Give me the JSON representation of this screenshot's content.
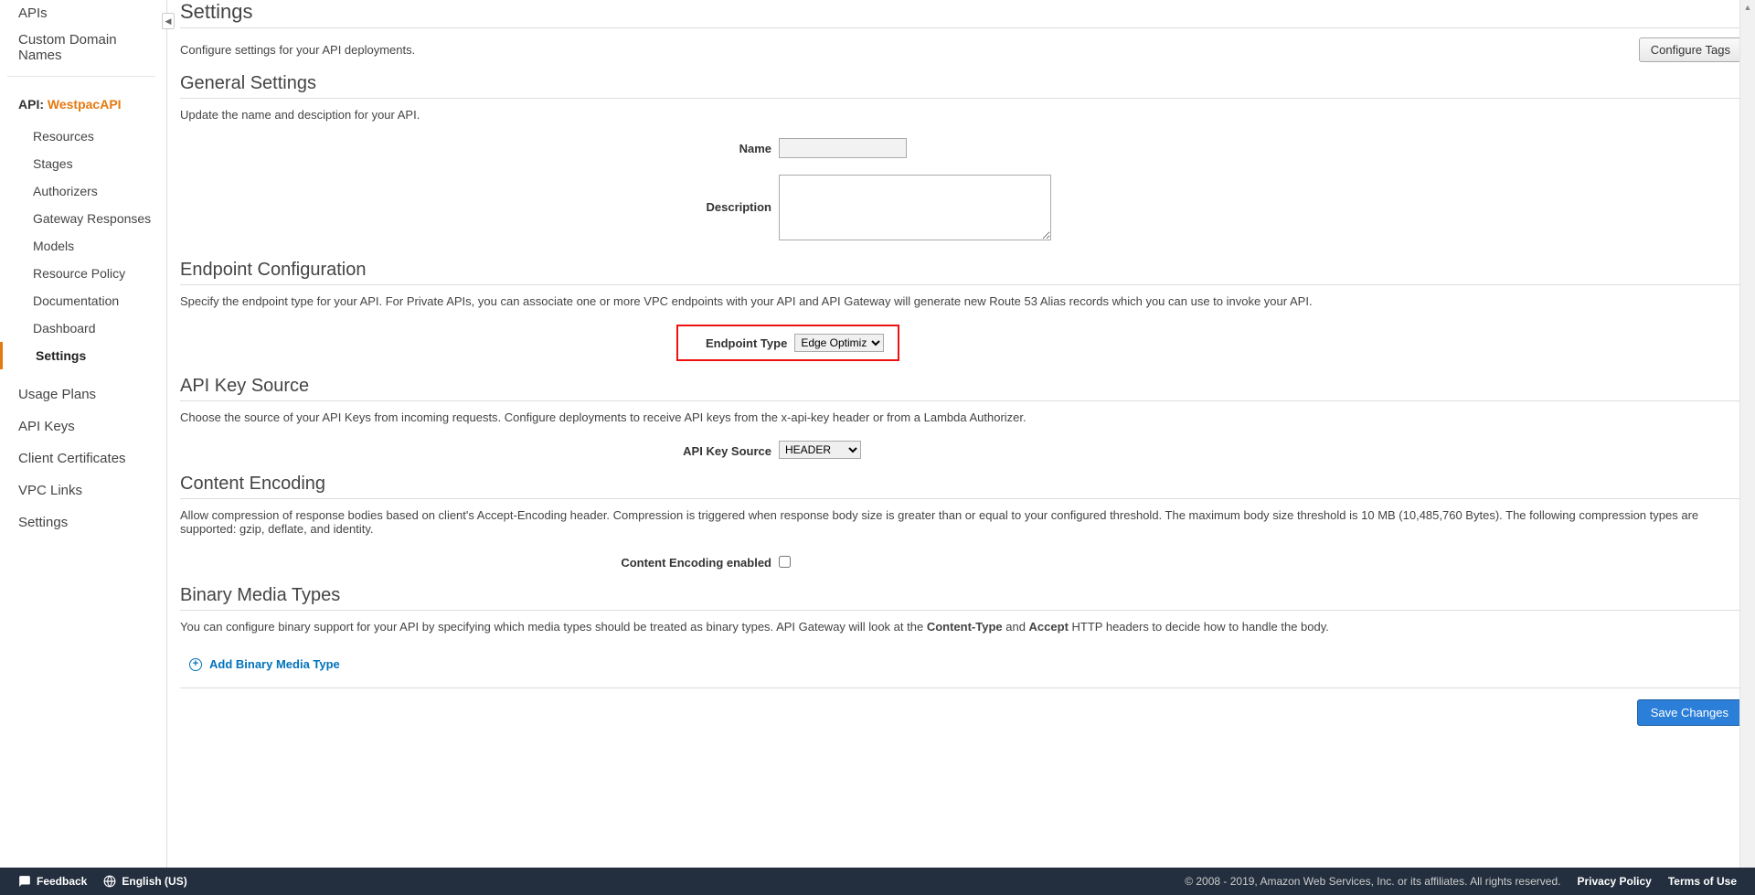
{
  "sidebar": {
    "top": [
      "APIs",
      "Custom Domain Names"
    ],
    "api_label_prefix": "API: ",
    "api_name": "WestpacAPI",
    "sub_items": [
      "Resources",
      "Stages",
      "Authorizers",
      "Gateway Responses",
      "Models",
      "Resource Policy",
      "Documentation",
      "Dashboard",
      "Settings"
    ],
    "active_sub_index": 8,
    "lower": [
      "Usage Plans",
      "API Keys",
      "Client Certificates",
      "VPC Links",
      "Settings"
    ]
  },
  "main": {
    "title": "Settings",
    "intro": "Configure settings for your API deployments.",
    "configure_tags_btn": "Configure Tags",
    "sections": {
      "general": {
        "title": "General Settings",
        "desc": "Update the name and desciption for your API.",
        "name_label": "Name",
        "name_value": "",
        "desc_label": "Description",
        "desc_value": ""
      },
      "endpoint": {
        "title": "Endpoint Configuration",
        "desc": "Specify the endpoint type for your API. For Private APIs, you can associate one or more VPC endpoints with your API and API Gateway will generate new Route 53 Alias records which you can use to invoke your API.",
        "label": "Endpoint Type",
        "value": "Edge Optimized"
      },
      "apikey": {
        "title": "API Key Source",
        "desc": "Choose the source of your API Keys from incoming requests. Configure deployments to receive API keys from the x-api-key header or from a Lambda Authorizer.",
        "label": "API Key Source",
        "value": "HEADER"
      },
      "encoding": {
        "title": "Content Encoding",
        "desc": "Allow compression of response bodies based on client's Accept-Encoding header. Compression is triggered when response body size is greater than or equal to your configured threshold. The maximum body size threshold is 10 MB (10,485,760 Bytes). The following compression types are supported: gzip, deflate, and identity.",
        "label": "Content Encoding enabled"
      },
      "binary": {
        "title": "Binary Media Types",
        "desc_pre": "You can configure binary support for your API by specifying which media types should be treated as binary types. API Gateway will look at the ",
        "content_type": "Content-Type",
        "and": " and ",
        "accept": "Accept",
        "desc_post": " HTTP headers to decide how to handle the body.",
        "add_link": "Add Binary Media Type"
      }
    },
    "save_btn": "Save Changes"
  },
  "footer": {
    "feedback": "Feedback",
    "language": "English (US)",
    "copyright": "© 2008 - 2019, Amazon Web Services, Inc. or its affiliates. All rights reserved.",
    "privacy": "Privacy Policy",
    "terms": "Terms of Use"
  }
}
